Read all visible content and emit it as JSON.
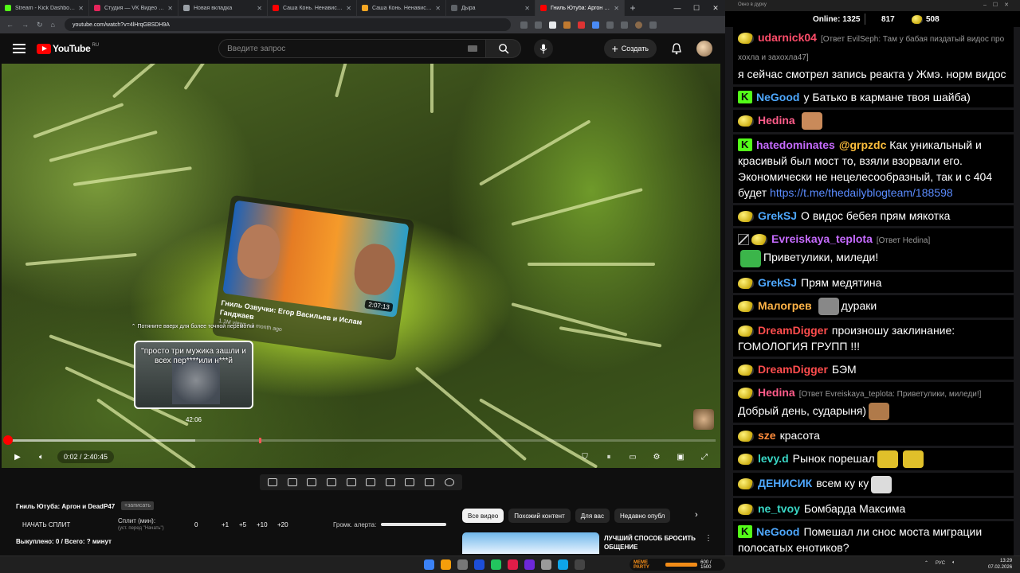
{
  "browser": {
    "tabs": [
      {
        "label": "Stream - Kick Dashboard",
        "color": "#53fc18",
        "active": false
      },
      {
        "label": "Студия — VK Видео Live",
        "color": "#e5245b",
        "active": false
      },
      {
        "label": "Новая вкладка",
        "color": "#9aa0a6",
        "active": false
      },
      {
        "label": "Саша Конь. Ненависть к Стр",
        "color": "#ff0000",
        "active": false
      },
      {
        "label": "Саша Конь. Ненависть к Стр",
        "color": "#f5a623",
        "active": false
      },
      {
        "label": "Дыра",
        "color": "#5f6368",
        "active": false
      },
      {
        "label": "Гниль Ютуба: Аргон и DeadP47",
        "color": "#ff0000",
        "active": true
      }
    ],
    "url": "youtube.com/watch?v=4lHrqGBSDH9A"
  },
  "youtube": {
    "logo_word": "YouTube",
    "logo_region": "RU",
    "search_placeholder": "Введите запрос",
    "create_label": "Создать",
    "player": {
      "card_title": "Гниль Озвучки: Егор Васильев и Ислам Ганджаев",
      "card_meta": "1.1M views • 1 month ago",
      "card_duration": "2:07:13",
      "seek_hint": "Потяните вверх для более точной перемотки",
      "preview_quote": "\"просто три мужика зашли и всех пер****или н***й",
      "preview_time": "42:06",
      "time_display": "0:02 / 2:40:45",
      "progress_played_fraction": 0.0002,
      "progress_buffer_fraction": 0.265
    },
    "title": "Гниль Ютуба: Аргон и DeadP47",
    "title_badge": "+записать",
    "split": {
      "start_label": "НАЧАТЬ СПЛИТ",
      "minutes_label": "Сплит (мин):",
      "minutes_hint": "(уст. перед \"Начать\")",
      "value": "0",
      "increments": [
        "+1",
        "+5",
        "+10",
        "+20"
      ],
      "alert_label": "Громк. алерта:",
      "alert_volume_fraction": 1.0
    },
    "bought_label": "Выкуплено: 0 / Всего: ? минут",
    "chips": [
      "Все видео",
      "Похожий контент",
      "Для вас",
      "Недавно опубл"
    ],
    "recommendation_title": "ЛУЧШИЙ СПОСОБ БРОСИТЬ ОБЩЕНИЕ"
  },
  "chat": {
    "window_title": "Окно в дурку",
    "online_label": "Online:",
    "online_count": "1325",
    "kick_count": "817",
    "twitch_count": "508",
    "messages": [
      {
        "platform": "twitch",
        "user": "udarnick04",
        "color": "#ff4d6a",
        "reply": "[Ответ EvilSeph: Там у бабая пиздатый видос про хохла и захохла47]",
        "text": "я сейчас смотрел запись реакта у Жмэ. норм видос"
      },
      {
        "platform": "kick",
        "user": "NeGood",
        "color": "#4ea8ff",
        "text": "у Батько в кармане твоя шайба)"
      },
      {
        "platform": "twitch",
        "user": "Hedina",
        "color": "#ff5c8a",
        "text": "",
        "emote": "#c98a5a"
      },
      {
        "platform": "kick",
        "user": "hatedominates",
        "color": "#c66bff",
        "mention": "@grpzdc",
        "text": "Как уникальный и красивый был мост то, взяли взорвали его. Экономически не нецелесообразный, так и с 404 будет",
        "link": "https://t.me/thedailyblogteam/188598"
      },
      {
        "platform": "twitch",
        "user": "GrekSJ",
        "color": "#4ea8ff",
        "text": "О видос бебея прям мякотка"
      },
      {
        "platform": "twitch-sword",
        "user": "Evreiskaya_teplota",
        "color": "#c66bff",
        "reply": "[Ответ Hedina]",
        "text": "Приветулики, миледи!",
        "emote_first": "#3bb54a"
      },
      {
        "platform": "twitch",
        "user": "GrekSJ",
        "color": "#4ea8ff",
        "text": "Прям медятина"
      },
      {
        "platform": "twitch",
        "user": "Малогрев",
        "color": "#ffb347",
        "text": "дураки",
        "emote_first": "#888888"
      },
      {
        "platform": "twitch",
        "user": "DreamDigger",
        "color": "#ff4d4d",
        "text": "произношу заклинание: ГОМОЛОГИЯ ГРУПП !!!"
      },
      {
        "platform": "twitch",
        "user": "DreamDigger",
        "color": "#ff4d4d",
        "text": "БЭМ"
      },
      {
        "platform": "twitch",
        "user": "Hedina",
        "color": "#ff5c8a",
        "reply": "[Ответ Evreiskaya_teplota: Приветулики, миледи!]",
        "text": "Добрый день, сударыня)",
        "emote": "#b07a4a"
      },
      {
        "platform": "twitch",
        "user": "sze",
        "color": "#ff8c3c",
        "text": "красота"
      },
      {
        "platform": "twitch",
        "user": "levy.d",
        "color": "#39d6c5",
        "text": "Рынок порешал",
        "emote": "#e0c02a",
        "emote2": "#e0c02a"
      },
      {
        "platform": "twitch",
        "user": "ДЕНИСИК",
        "color": "#4ea8ff",
        "text": "всем ку ку",
        "emote": "#dcdcdc"
      },
      {
        "platform": "twitch",
        "user": "ne_tvoy",
        "color": "#39d6c5",
        "text": "Бомбарда Максима"
      },
      {
        "platform": "kick",
        "user": "NeGood",
        "color": "#4ea8ff",
        "text": "Помешал ли снос моста миграции полосатых енотиков?"
      }
    ]
  },
  "taskbar": {
    "widget_label": "MEME PARTY",
    "widget_value": "600 / 1500",
    "lang": "РУС",
    "time": "13:29",
    "date": "07.02.2026"
  }
}
